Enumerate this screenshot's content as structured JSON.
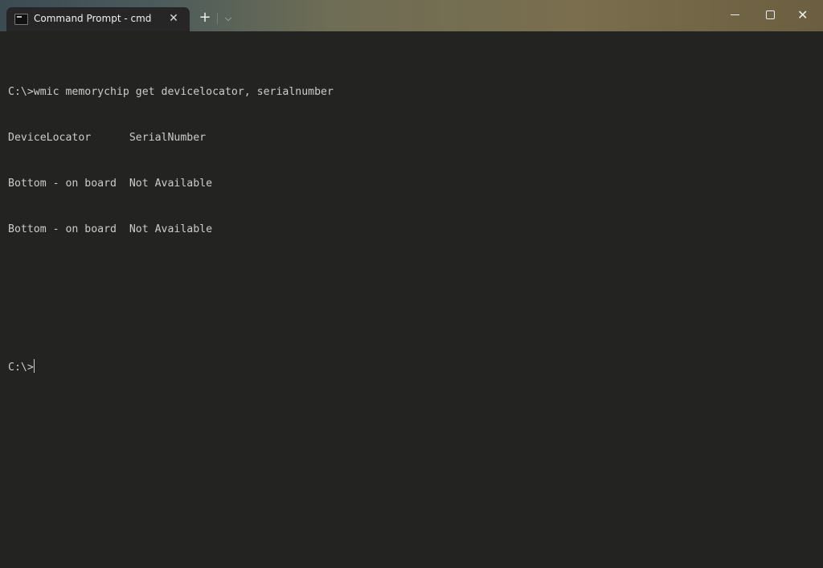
{
  "window": {
    "tab_title": "Command Prompt - cmd",
    "tab_close_glyph": "✕",
    "new_tab_glyph": "+",
    "dropdown_glyph": "⌵",
    "close_glyph": "✕"
  },
  "terminal": {
    "lines": [
      "C:\\>wmic memorychip get devicelocator, serialnumber",
      "DeviceLocator      SerialNumber",
      "Bottom - on board  Not Available",
      "Bottom - on board  Not Available",
      "",
      "",
      ""
    ],
    "prompt": "C:\\>"
  }
}
